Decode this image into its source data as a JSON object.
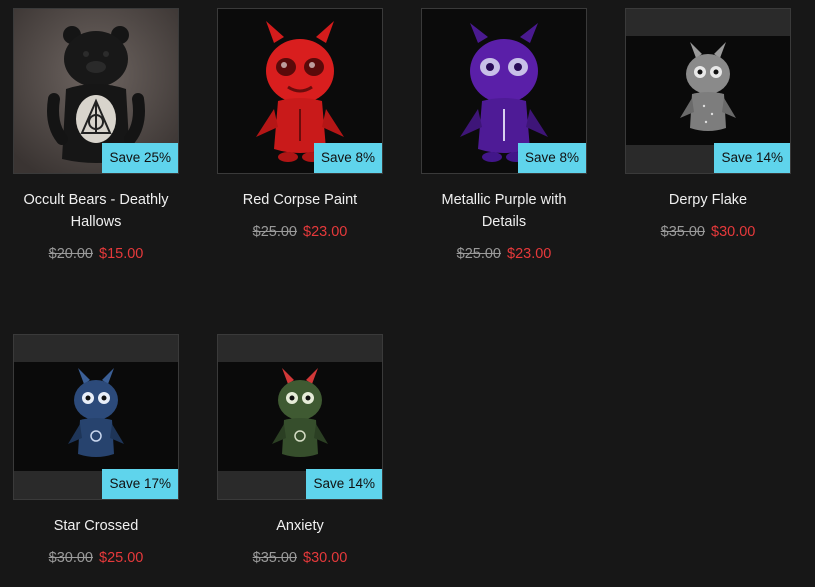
{
  "products": [
    {
      "title": "Occult Bears - Deathly Hallows",
      "badge": "Save 25%",
      "old_price": "$20.00",
      "new_price": "$15.00",
      "figure_color": "#1a1a1a",
      "image": "black bear figure with deathly hallows symbol"
    },
    {
      "title": "Red Corpse Paint",
      "badge": "Save 8%",
      "old_price": "$25.00",
      "new_price": "$23.00",
      "figure_color": "#d91e1e",
      "image": "red horned figure"
    },
    {
      "title": "Metallic Purple with Details",
      "badge": "Save 8%",
      "old_price": "$25.00",
      "new_price": "$23.00",
      "figure_color": "#5a1fa8",
      "image": "metallic purple horned figure"
    },
    {
      "title": "Derpy Flake",
      "badge": "Save 14%",
      "old_price": "$35.00",
      "new_price": "$30.00",
      "figure_color": "#8a8a8a",
      "image": "silver flake horned figure"
    },
    {
      "title": "Star Crossed",
      "badge": "Save 17%",
      "old_price": "$30.00",
      "new_price": "$25.00",
      "figure_color": "#2c4a7a",
      "image": "blue starry horned figure"
    },
    {
      "title": "Anxiety",
      "badge": "Save 14%",
      "old_price": "$35.00",
      "new_price": "$30.00",
      "figure_color": "#3f5a32",
      "image": "green horned figure with red horn"
    }
  ],
  "colors": {
    "badge": "#5fd4ec",
    "sale_price": "#e5393b",
    "old_price": "#9a9a9a",
    "background": "#171717"
  }
}
